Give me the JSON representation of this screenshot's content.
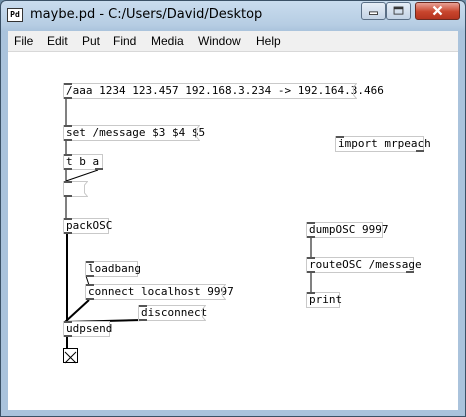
{
  "window": {
    "app_icon_text": "Pd",
    "title": "maybe.pd  - C:/Users/David/Desktop"
  },
  "menubar": {
    "items": [
      "File",
      "Edit",
      "Put",
      "Find",
      "Media",
      "Window",
      "Help"
    ]
  },
  "patch": {
    "msg_aaa": "/aaa 1234 123.457 192.168.3.234 -> 192.164.3.466",
    "msg_set": "set /message $3 $4 $5",
    "obj_tba": "t b a",
    "msg_empty": "",
    "obj_packosc": "packOSC",
    "obj_loadbang": "loadbang",
    "msg_connect": "connect localhost 9997",
    "msg_disconnect": "disconnect",
    "obj_udpsend": "udpsend",
    "obj_import": "import mrpeach",
    "obj_dumposc": "dumpOSC 9997",
    "obj_routeosc": "routeOSC /message",
    "obj_print": "print"
  }
}
